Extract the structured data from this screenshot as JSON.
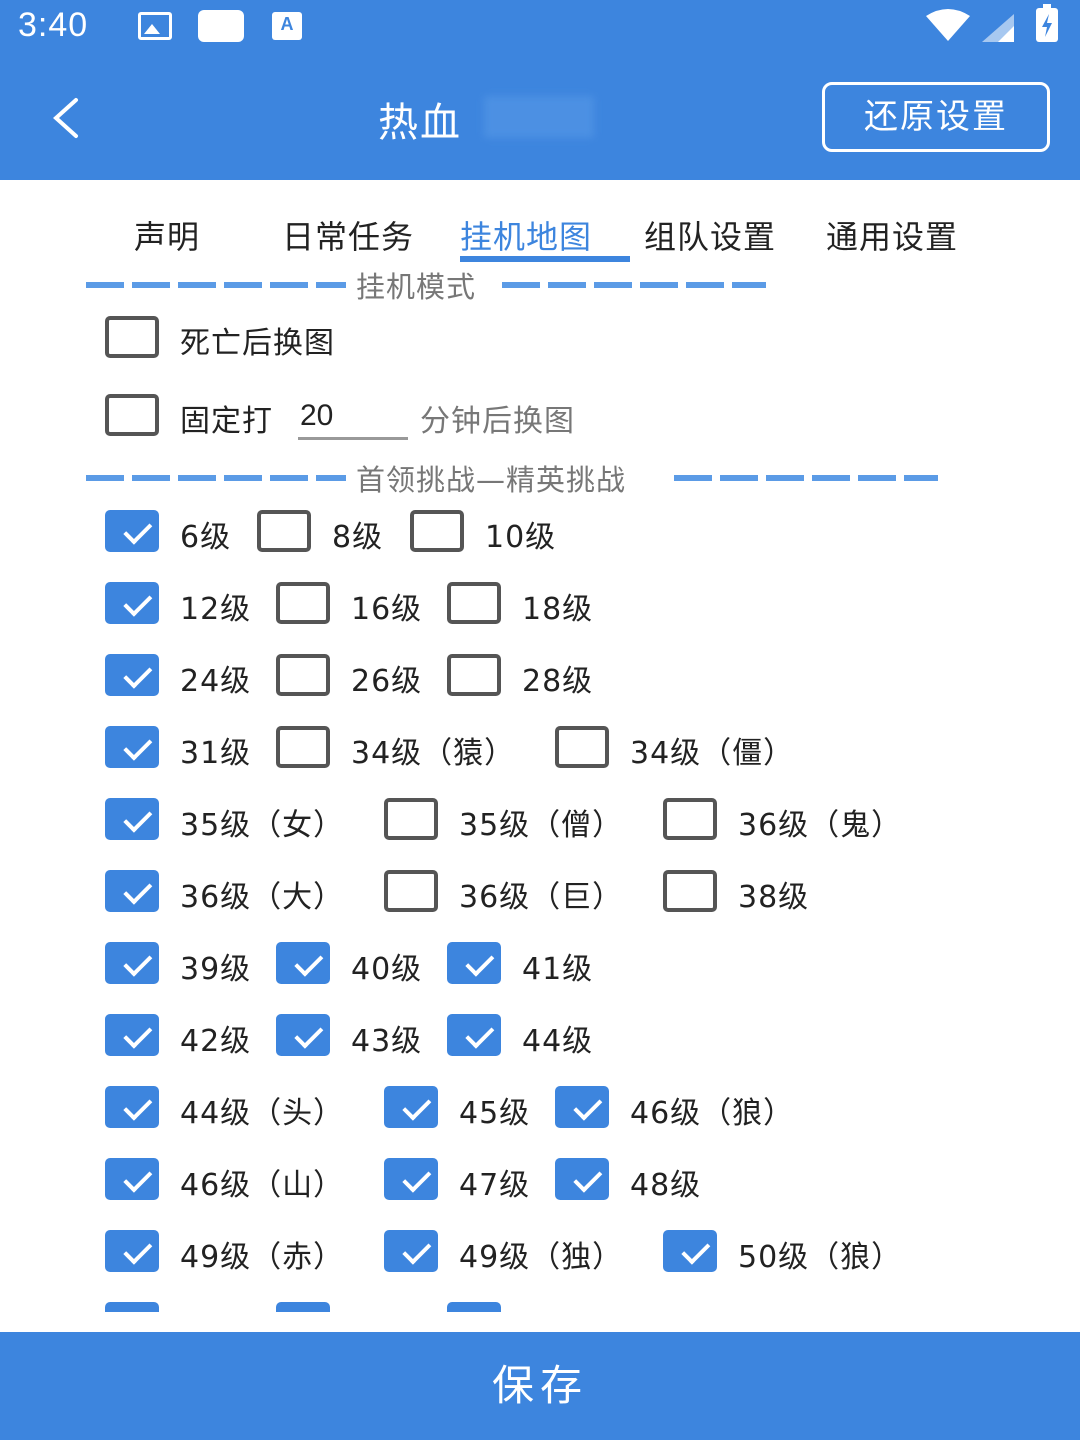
{
  "status_bar": {
    "time": "3:40"
  },
  "header": {
    "title": "热血",
    "reset_label": "还原设置"
  },
  "tabs": [
    {
      "label": "声明"
    },
    {
      "label": "日常任务"
    },
    {
      "label": "挂机地图"
    },
    {
      "label": "组队设置"
    },
    {
      "label": "通用设置"
    }
  ],
  "mode_section": {
    "title": "挂机模式",
    "death_switch_label": "死亡后换图",
    "fixed_label": "固定打",
    "minutes_value": "20",
    "fixed_suffix": "分钟后换图"
  },
  "boss_section": {
    "title": "首领挑战—精英挑战",
    "options": [
      {
        "label": "6级",
        "checked": true
      },
      {
        "label": "8级",
        "checked": false
      },
      {
        "label": "10级",
        "checked": false
      },
      {
        "label": "12级",
        "checked": true
      },
      {
        "label": "16级",
        "checked": false
      },
      {
        "label": "18级",
        "checked": false
      },
      {
        "label": "24级",
        "checked": true
      },
      {
        "label": "26级",
        "checked": false
      },
      {
        "label": "28级",
        "checked": false
      },
      {
        "label": "31级",
        "checked": true
      },
      {
        "label": "34级（猿）",
        "checked": false
      },
      {
        "label": "34级（僵）",
        "checked": false
      },
      {
        "label": "35级（女）",
        "checked": true
      },
      {
        "label": "35级（僧）",
        "checked": false
      },
      {
        "label": "36级（鬼）",
        "checked": false
      },
      {
        "label": "36级（大）",
        "checked": true
      },
      {
        "label": "36级（巨）",
        "checked": false
      },
      {
        "label": "38级",
        "checked": false
      },
      {
        "label": "39级",
        "checked": true
      },
      {
        "label": "40级",
        "checked": true
      },
      {
        "label": "41级",
        "checked": true
      },
      {
        "label": "42级",
        "checked": true
      },
      {
        "label": "43级",
        "checked": true
      },
      {
        "label": "44级",
        "checked": true
      },
      {
        "label": "44级（头）",
        "checked": true
      },
      {
        "label": "45级",
        "checked": true
      },
      {
        "label": "46级（狼）",
        "checked": true
      },
      {
        "label": "46级（山）",
        "checked": true
      },
      {
        "label": "47级",
        "checked": true
      },
      {
        "label": "48级",
        "checked": true
      },
      {
        "label": "49级（赤）",
        "checked": true
      },
      {
        "label": "49级（独）",
        "checked": true
      },
      {
        "label": "50级（狼）",
        "checked": true
      }
    ]
  },
  "footer": {
    "save_label": "保存"
  },
  "colors": {
    "primary": "#3d85de",
    "text": "#222222",
    "muted": "#777777"
  }
}
